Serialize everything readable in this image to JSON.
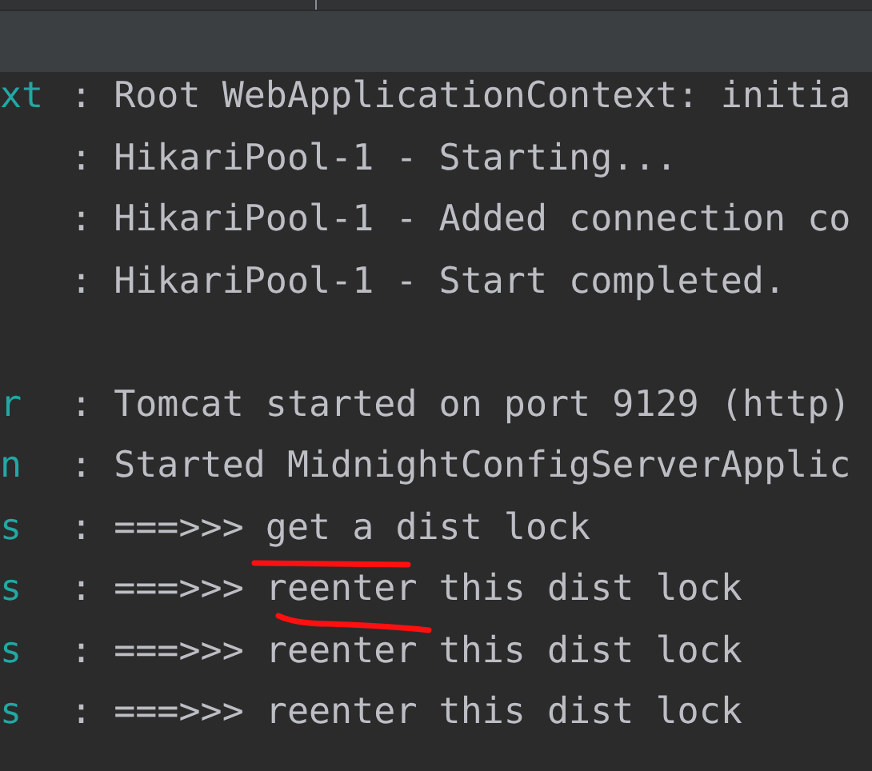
{
  "console_lines": [
    {
      "kind": "log",
      "source": "xt",
      "message": ": Root WebApplicationContext: initia"
    },
    {
      "kind": "log",
      "message": ": HikariPool-1 - Starting..."
    },
    {
      "kind": "log",
      "message": ": HikariPool-1 - Added connection co"
    },
    {
      "kind": "log",
      "message": ": HikariPool-1 - Start completed."
    },
    {
      "kind": "blank"
    },
    {
      "kind": "log",
      "source": "r",
      "message": ": Tomcat started on port 9129 (http)"
    },
    {
      "kind": "log",
      "source": "n",
      "message": ": Started MidnightConfigServerApplic"
    },
    {
      "kind": "log",
      "source": "s",
      "message": ": ===>>> get a dist lock"
    },
    {
      "kind": "log",
      "source": "s",
      "message": ": ===>>> reenter this dist lock"
    },
    {
      "kind": "log",
      "source": "s",
      "message": ": ===>>> reenter this dist lock"
    },
    {
      "kind": "log",
      "source": "s",
      "message": ": ===>>> reenter this dist lock"
    }
  ]
}
